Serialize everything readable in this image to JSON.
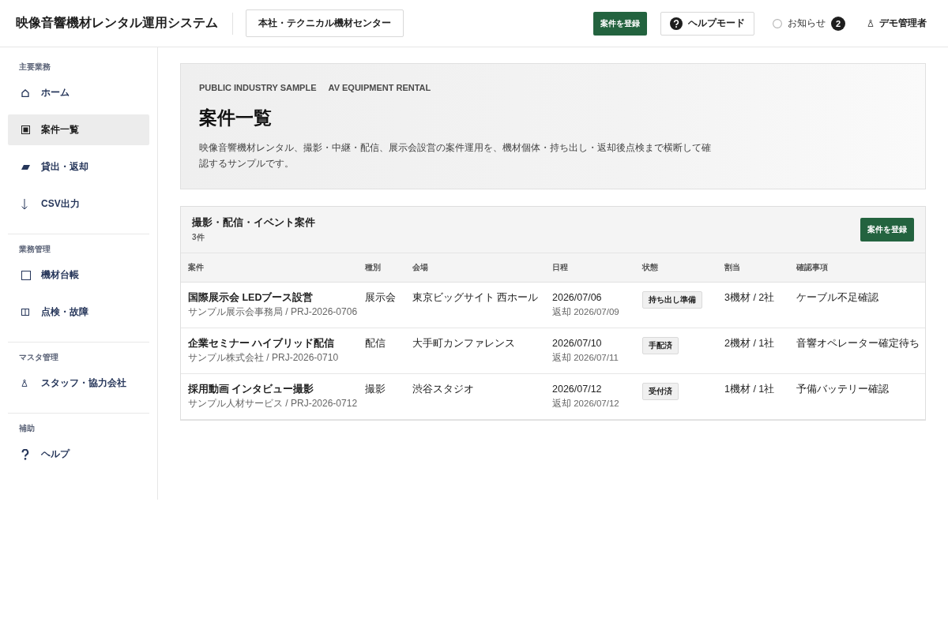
{
  "header": {
    "title": "映像音響機材レンタル運用システム",
    "location_button": "本社・テクニカル機材センター",
    "register_button": "案件を登録",
    "help_mode_button": "ヘルプモード",
    "notifications": {
      "label": "お知らせ",
      "count": "2"
    },
    "user": "デモ管理者"
  },
  "sidebar": {
    "sections": [
      {
        "heading": "主要業務",
        "items": [
          {
            "label": "ホーム",
            "selected": false
          },
          {
            "label": "案件一覧",
            "selected": true
          },
          {
            "label": "貸出・返却",
            "selected": false
          },
          {
            "label": "CSV出力",
            "selected": false
          }
        ]
      },
      {
        "heading": "業務管理",
        "items": [
          {
            "label": "機材台帳",
            "selected": false
          },
          {
            "label": "点検・故障",
            "selected": false
          }
        ]
      },
      {
        "heading": "マスタ管理",
        "items": [
          {
            "label": "スタッフ・協力会社",
            "selected": false
          }
        ]
      },
      {
        "heading": "補助",
        "items": [
          {
            "label": "ヘルプ",
            "selected": false
          }
        ]
      }
    ]
  },
  "hero": {
    "eyebrow": [
      "PUBLIC INDUSTRY SAMPLE",
      "AV EQUIPMENT RENTAL"
    ],
    "title": "案件一覧",
    "description": "映像音響機材レンタル、撮影・中継・配信、展示会設営の案件運用を、機材個体・持ち出し・返却後点検まで横断して確認するサンプルです。"
  },
  "projects_panel": {
    "title": "撮影・配信・イベント案件",
    "count": "3件",
    "register_button": "案件を登録",
    "table": {
      "columns": [
        "案件",
        "種別",
        "会場",
        "日程",
        "状態",
        "割当",
        "確認事項"
      ],
      "rows": [
        {
          "name": "国際展示会 LEDブース設営",
          "client": "サンプル展示会事務局 / PRJ-2026-0706",
          "type": "展示会",
          "venue": "東京ビッグサイト 西ホール",
          "date": "2026/07/06",
          "return": "返却 2026/07/09",
          "status": "持ち出し準備",
          "allocation": "3機材 / 2社",
          "check": "ケーブル不足確認"
        },
        {
          "name": "企業セミナー ハイブリッド配信",
          "client": "サンプル株式会社 / PRJ-2026-0710",
          "type": "配信",
          "venue": "大手町カンファレンス",
          "date": "2026/07/10",
          "return": "返却 2026/07/11",
          "status": "手配済",
          "allocation": "2機材 / 1社",
          "check": "音響オペレーター確定待ち"
        },
        {
          "name": "採用動画 インタビュー撮影",
          "client": "サンプル人材サービス / PRJ-2026-0712",
          "type": "撮影",
          "venue": "渋谷スタジオ",
          "date": "2026/07/12",
          "return": "返却 2026/07/12",
          "status": "受付済",
          "allocation": "1機材 / 1社",
          "check": "予備バッテリー確認"
        }
      ]
    }
  }
}
